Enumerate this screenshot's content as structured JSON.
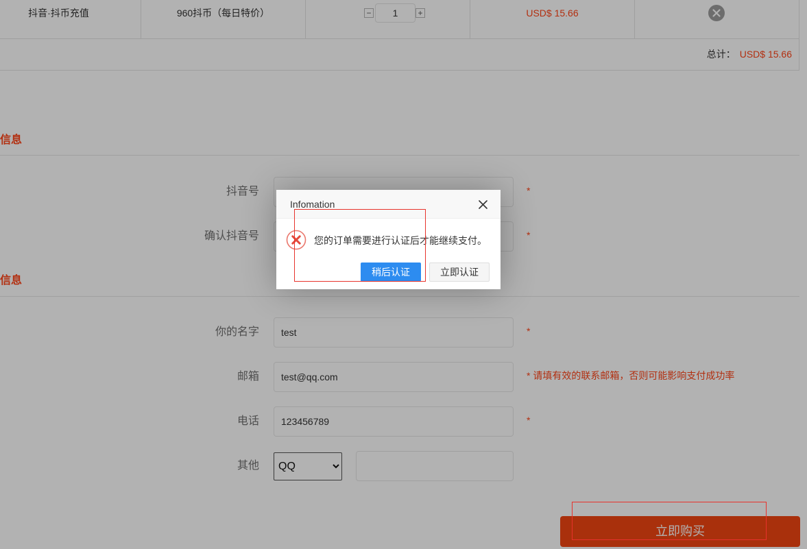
{
  "colors": {
    "accent": "#ff4418",
    "submit": "#f24612",
    "primary": "#2d8cf0",
    "error": "#e34a3b",
    "annot": "#e8322b"
  },
  "cart": {
    "rows": [
      {
        "product": "抖音·抖币充值",
        "spec": "960抖币（每日特价）",
        "quantity": "1",
        "price": "USD$ 15.66",
        "remove_icon": "close-circle-icon"
      }
    ],
    "decrement_label": "−",
    "increment_label": "+",
    "total_label": "总计：",
    "total_value": "USD$ 15.66"
  },
  "account_section": {
    "title": "信息",
    "fields": [
      {
        "label": "抖音号",
        "mark": "*"
      },
      {
        "label": "确认抖音号",
        "mark": "*"
      }
    ]
  },
  "contact_section": {
    "title": "信息",
    "name": {
      "label": "你的名字",
      "value": "test",
      "mark": "*"
    },
    "email": {
      "label": "邮箱",
      "value": "test@qq.com",
      "mark": "* 请填有效的联系邮箱，否则可能影响支付成功率"
    },
    "phone": {
      "label": "电话",
      "value": "123456789",
      "mark": "*"
    },
    "other": {
      "label": "其他",
      "selected": "QQ"
    }
  },
  "submit_label": "立即购买",
  "dialog": {
    "title": "Infomation",
    "close_icon": "close-icon",
    "status_icon": "error-circle-icon",
    "message": "您的订单需要进行认证后才能继续支付。",
    "later_label": "稍后认证",
    "verify_label": "立即认证"
  }
}
